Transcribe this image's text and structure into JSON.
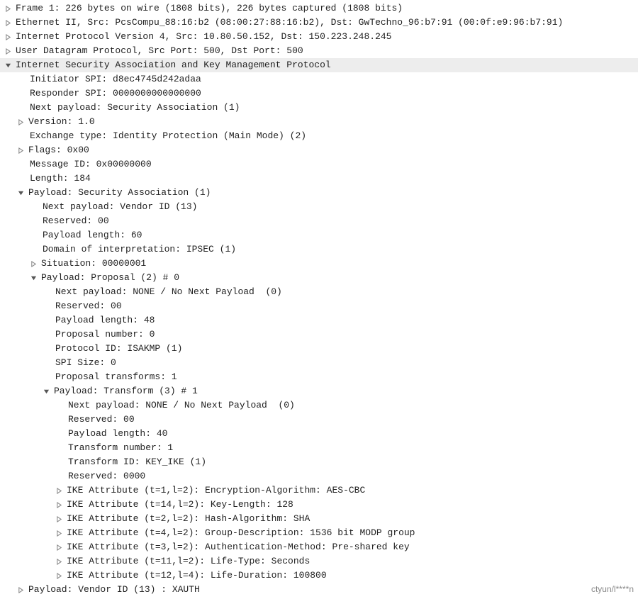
{
  "watermark": "ctyun/l****n",
  "tree": [
    {
      "depth": 0,
      "tw": "r",
      "sel": false,
      "text": "Frame 1: 226 bytes on wire (1808 bits), 226 bytes captured (1808 bits)"
    },
    {
      "depth": 0,
      "tw": "r",
      "sel": false,
      "text": "Ethernet II, Src: PcsCompu_88:16:b2 (08:00:27:88:16:b2), Dst: GwTechno_96:b7:91 (00:0f:e9:96:b7:91)"
    },
    {
      "depth": 0,
      "tw": "r",
      "sel": false,
      "text": "Internet Protocol Version 4, Src: 10.80.50.152, Dst: 150.223.248.245"
    },
    {
      "depth": 0,
      "tw": "r",
      "sel": false,
      "text": "User Datagram Protocol, Src Port: 500, Dst Port: 500"
    },
    {
      "depth": 0,
      "tw": "d",
      "sel": true,
      "text": "Internet Security Association and Key Management Protocol"
    },
    {
      "depth": 1,
      "tw": "",
      "sel": false,
      "text": "Initiator SPI: d8ec4745d242adaa"
    },
    {
      "depth": 1,
      "tw": "",
      "sel": false,
      "text": "Responder SPI: 0000000000000000"
    },
    {
      "depth": 1,
      "tw": "",
      "sel": false,
      "text": "Next payload: Security Association (1)"
    },
    {
      "depth": 1,
      "tw": "r",
      "sel": false,
      "text": "Version: 1.0"
    },
    {
      "depth": 1,
      "tw": "",
      "sel": false,
      "text": "Exchange type: Identity Protection (Main Mode) (2)"
    },
    {
      "depth": 1,
      "tw": "r",
      "sel": false,
      "text": "Flags: 0x00"
    },
    {
      "depth": 1,
      "tw": "",
      "sel": false,
      "text": "Message ID: 0x00000000"
    },
    {
      "depth": 1,
      "tw": "",
      "sel": false,
      "text": "Length: 184"
    },
    {
      "depth": 1,
      "tw": "d",
      "sel": false,
      "text": "Payload: Security Association (1)"
    },
    {
      "depth": 2,
      "tw": "",
      "sel": false,
      "text": "Next payload: Vendor ID (13)"
    },
    {
      "depth": 2,
      "tw": "",
      "sel": false,
      "text": "Reserved: 00"
    },
    {
      "depth": 2,
      "tw": "",
      "sel": false,
      "text": "Payload length: 60"
    },
    {
      "depth": 2,
      "tw": "",
      "sel": false,
      "text": "Domain of interpretation: IPSEC (1)"
    },
    {
      "depth": 2,
      "tw": "r",
      "sel": false,
      "text": "Situation: 00000001"
    },
    {
      "depth": 2,
      "tw": "d",
      "sel": false,
      "text": "Payload: Proposal (2) # 0"
    },
    {
      "depth": 3,
      "tw": "",
      "sel": false,
      "text": "Next payload: NONE / No Next Payload  (0)"
    },
    {
      "depth": 3,
      "tw": "",
      "sel": false,
      "text": "Reserved: 00"
    },
    {
      "depth": 3,
      "tw": "",
      "sel": false,
      "text": "Payload length: 48"
    },
    {
      "depth": 3,
      "tw": "",
      "sel": false,
      "text": "Proposal number: 0"
    },
    {
      "depth": 3,
      "tw": "",
      "sel": false,
      "text": "Protocol ID: ISAKMP (1)"
    },
    {
      "depth": 3,
      "tw": "",
      "sel": false,
      "text": "SPI Size: 0"
    },
    {
      "depth": 3,
      "tw": "",
      "sel": false,
      "text": "Proposal transforms: 1"
    },
    {
      "depth": 3,
      "tw": "d",
      "sel": false,
      "text": "Payload: Transform (3) # 1"
    },
    {
      "depth": 4,
      "tw": "",
      "sel": false,
      "text": "Next payload: NONE / No Next Payload  (0)"
    },
    {
      "depth": 4,
      "tw": "",
      "sel": false,
      "text": "Reserved: 00"
    },
    {
      "depth": 4,
      "tw": "",
      "sel": false,
      "text": "Payload length: 40"
    },
    {
      "depth": 4,
      "tw": "",
      "sel": false,
      "text": "Transform number: 1"
    },
    {
      "depth": 4,
      "tw": "",
      "sel": false,
      "text": "Transform ID: KEY_IKE (1)"
    },
    {
      "depth": 4,
      "tw": "",
      "sel": false,
      "text": "Reserved: 0000"
    },
    {
      "depth": 4,
      "tw": "r",
      "sel": false,
      "text": "IKE Attribute (t=1,l=2): Encryption-Algorithm: AES-CBC"
    },
    {
      "depth": 4,
      "tw": "r",
      "sel": false,
      "text": "IKE Attribute (t=14,l=2): Key-Length: 128"
    },
    {
      "depth": 4,
      "tw": "r",
      "sel": false,
      "text": "IKE Attribute (t=2,l=2): Hash-Algorithm: SHA"
    },
    {
      "depth": 4,
      "tw": "r",
      "sel": false,
      "text": "IKE Attribute (t=4,l=2): Group-Description: 1536 bit MODP group"
    },
    {
      "depth": 4,
      "tw": "r",
      "sel": false,
      "text": "IKE Attribute (t=3,l=2): Authentication-Method: Pre-shared key"
    },
    {
      "depth": 4,
      "tw": "r",
      "sel": false,
      "text": "IKE Attribute (t=11,l=2): Life-Type: Seconds"
    },
    {
      "depth": 4,
      "tw": "r",
      "sel": false,
      "text": "IKE Attribute (t=12,l=4): Life-Duration: 100800"
    },
    {
      "depth": 1,
      "tw": "r",
      "sel": false,
      "text": "Payload: Vendor ID (13) : XAUTH"
    }
  ]
}
